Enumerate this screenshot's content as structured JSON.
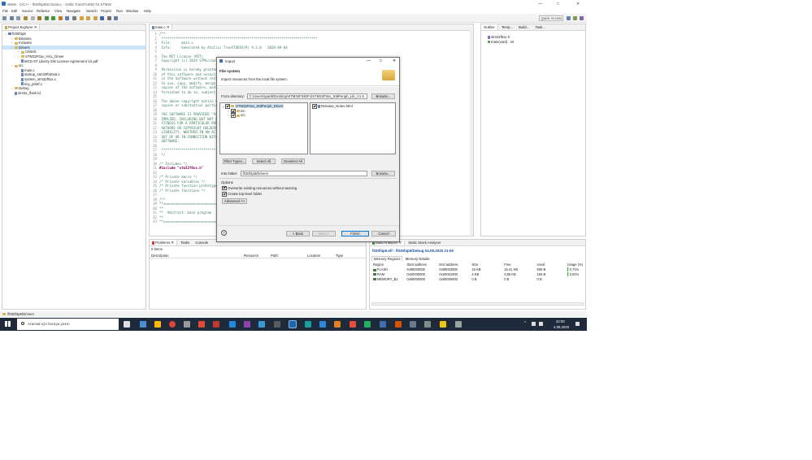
{
  "window": {
    "title": "stsMn - C/C++ - f030f4p6/src/main.c - Atollic TrueSTUDIO for STM32",
    "controls": [
      "—",
      "□",
      "✕"
    ]
  },
  "menu": [
    "File",
    "Edit",
    "Source",
    "Refactor",
    "View",
    "Navigate",
    "Search",
    "Project",
    "Run",
    "Window",
    "Help"
  ],
  "toolbar": {
    "quick_access": "Quick Access"
  },
  "project_explorer": {
    "tab": "Project Explorer",
    "tree": [
      {
        "label": "f030f4p6",
        "depth": 0,
        "kind": "project"
      },
      {
        "label": "Binaries",
        "depth": 1,
        "kind": "folder"
      },
      {
        "label": "Includes",
        "depth": 1,
        "kind": "folder"
      },
      {
        "label": "Drivers",
        "depth": 1,
        "kind": "folder",
        "selected": true
      },
      {
        "label": "CMSIS",
        "depth": 2,
        "kind": "folder"
      },
      {
        "label": "STM32F0xx_HAL_Driver",
        "depth": 2,
        "kind": "folder"
      },
      {
        "label": "MCD-ST Liberty SW License Agreement V2.pdf",
        "depth": 2,
        "kind": "file"
      },
      {
        "label": "src",
        "depth": 1,
        "kind": "folder"
      },
      {
        "label": "main.c",
        "depth": 2,
        "kind": "file"
      },
      {
        "label": "startup_stm32f030x6.s",
        "depth": 2,
        "kind": "file"
      },
      {
        "label": "system_stm32f0xx.c",
        "depth": 2,
        "kind": "file"
      },
      {
        "label": "tiny_printf.c",
        "depth": 2,
        "kind": "file"
      },
      {
        "label": "Debug",
        "depth": 1,
        "kind": "folder"
      },
      {
        "label": "stm32_flash.ld",
        "depth": 1,
        "kind": "file"
      }
    ]
  },
  "editor": {
    "tab": "main.c",
    "lines": [
      {
        "n": "1",
        "text": "/**",
        "cls": "cmt"
      },
      {
        "n": "2",
        "text": " ******************************************************************************",
        "cls": "cmt"
      },
      {
        "n": "3",
        "text": " File:     main.c",
        "cls": "cmt"
      },
      {
        "n": "4",
        "text": " Info:     Generated by Atollic TrueSTUDIO(R) 9.3.0   2020-09-04",
        "cls": "cmt"
      },
      {
        "n": "5",
        "text": "",
        "cls": "cmt"
      },
      {
        "n": "6",
        "text": " The MIT License (MIT)",
        "cls": "cmt"
      },
      {
        "n": "7",
        "text": " Copyright (c) 2019 STMicroelectronics",
        "cls": "cmt"
      },
      {
        "n": "8",
        "text": "",
        "cls": "cmt"
      },
      {
        "n": "9",
        "text": " Permission is hereby granted, free of charge, to any person obtaining a copy",
        "cls": "cmt"
      },
      {
        "n": "10",
        "text": " of this software and associated documentation files (the \"Software\"), to deal",
        "cls": "cmt"
      },
      {
        "n": "11",
        "text": " in the Software without restriction, including without limitation the rights",
        "cls": "cmt"
      },
      {
        "n": "12",
        "text": " to use, copy, modify, merge, publish, distribute, sublicense, and/or sell",
        "cls": "cmt"
      },
      {
        "n": "13",
        "text": " copies of the Software, and to permit persons to whom the Software is",
        "cls": "cmt"
      },
      {
        "n": "14",
        "text": " furnished to do so, subject to the following conditions:",
        "cls": "cmt"
      },
      {
        "n": "15",
        "text": "",
        "cls": "cmt"
      },
      {
        "n": "16",
        "text": " The above copyright notice and this permission notice shall be included in all",
        "cls": "cmt"
      },
      {
        "n": "17",
        "text": " copies or substantial portions of the Software.",
        "cls": "cmt"
      },
      {
        "n": "18",
        "text": "",
        "cls": "cmt"
      },
      {
        "n": "19",
        "text": " THE SOFTWARE IS PROVIDED \"AS IS\", WITHOUT WARRANTY OF ANY KIND, EXPRESS OR",
        "cls": "cmt"
      },
      {
        "n": "20",
        "text": " IMPLIED, INCLUDING BUT NOT LIMITED TO THE WARRANTIES OF MERCHANTABILITY,",
        "cls": "cmt"
      },
      {
        "n": "21",
        "text": " FITNESS FOR A PARTICULAR PURPOSE AND NONINFRINGEMENT. IN NO EVENT SHALL THE",
        "cls": "cmt"
      },
      {
        "n": "22",
        "text": " AUTHORS OR COPYRIGHT HOLDERS BE LIABLE FOR ANY CLAIM, DAMAGES OR OTHER",
        "cls": "cmt"
      },
      {
        "n": "23",
        "text": " LIABILITY, WHETHER IN AN ACTION OF CONTRACT, TORT OR OTHERWISE, ARISING FROM,",
        "cls": "cmt"
      },
      {
        "n": "24",
        "text": " OUT OF OR IN CONNECTION WITH THE SOFTWARE OR THE USE OR OTHER DEALINGS IN THE",
        "cls": "cmt"
      },
      {
        "n": "25",
        "text": " SOFTWARE.",
        "cls": "cmt"
      },
      {
        "n": "26",
        "text": "",
        "cls": "cmt"
      },
      {
        "n": "27",
        "text": " ******************************************************************************",
        "cls": "cmt"
      },
      {
        "n": "28",
        "text": " */",
        "cls": "cmt"
      },
      {
        "n": "29",
        "text": "",
        "cls": ""
      },
      {
        "n": "30",
        "text": "/* Includes */",
        "cls": "cmt"
      },
      {
        "n": "31",
        "text": "#include \"stm32f0xx.h\"",
        "cls": "kw"
      },
      {
        "n": "32",
        "text": "",
        "cls": ""
      },
      {
        "n": "33",
        "text": "/* Private macro */",
        "cls": "cmt"
      },
      {
        "n": "34",
        "text": "/* Private variables */",
        "cls": "cmt"
      },
      {
        "n": "35",
        "text": "/* Private function prototypes */",
        "cls": "cmt"
      },
      {
        "n": "36",
        "text": "/* Private functions */",
        "cls": "cmt"
      },
      {
        "n": "37",
        "text": "",
        "cls": ""
      },
      {
        "n": "38",
        "text": "/**",
        "cls": "cmt"
      },
      {
        "n": "39",
        "text": "**===========================================================================",
        "cls": "cmt"
      },
      {
        "n": "40",
        "text": "**",
        "cls": "cmt"
      },
      {
        "n": "41",
        "text": "**  Abstract: main program",
        "cls": "cmt"
      },
      {
        "n": "42",
        "text": "**",
        "cls": "cmt"
      },
      {
        "n": "43",
        "text": "**===========================================================================",
        "cls": "cmt"
      }
    ]
  },
  "outline": {
    "tabs": [
      "Outline",
      "Temp...",
      "Build...",
      "Task..."
    ],
    "items": [
      "stm32f0xx.h",
      "main(void) : int"
    ]
  },
  "problems": {
    "tabs": [
      "Problems",
      "Tasks",
      "Console"
    ],
    "count": "0 items",
    "columns": [
      "Description",
      "Resource",
      "Path",
      "Location",
      "Type"
    ]
  },
  "build_analyzer": {
    "tabs": [
      "Build Analyzer",
      "Static Stack Analyzer"
    ],
    "header": "f030f4p6.elf - /f030f4p6/Debug   04.09.2020 21:50",
    "subtabs": [
      "Memory Regions",
      "Memory Details"
    ],
    "columns": [
      "Region",
      "Start address",
      "End address",
      "Size",
      "Free",
      "Used",
      "Usage (%)"
    ],
    "rows": [
      {
        "region": "FLASH",
        "start": "0x08000000",
        "end": "0x08004000",
        "size": "16 KB",
        "free": "15,41 KB",
        "used": "608 B",
        "usage": "3,71%",
        "pct": 3.71
      },
      {
        "region": "RAM",
        "start": "0x20000000",
        "end": "0x20001000",
        "size": "4 KB",
        "free": "3,85 KB",
        "used": "156 B",
        "usage": "3,81%",
        "pct": 3.81
      },
      {
        "region": "MEMORY_B1",
        "start": "0x60000000",
        "end": "0x60000000",
        "size": "0 B",
        "free": "0 B",
        "used": "0 B",
        "usage": "",
        "pct": 0
      }
    ]
  },
  "status_bar": {
    "path": "/f030f4p6/Drivers"
  },
  "dialog": {
    "title": "Import",
    "heading": "File system",
    "description": "Import resources from the local file system.",
    "from_dir_label": "From directory:",
    "from_dir_value": "C:\\Users\\sparkt\\Desktop\\STM32F030F4\\STM32F0xx_StdPeriph_Lib_V1.5",
    "browse": "Browse...",
    "tree": [
      {
        "label": "STM32F0xx_StdPeriph_Driver",
        "depth": 0,
        "checked": true,
        "selected": true
      },
      {
        "label": "inc",
        "depth": 1,
        "checked": true
      },
      {
        "label": "src",
        "depth": 1,
        "checked": true
      }
    ],
    "files": [
      {
        "label": "Release_Notes.html",
        "checked": true
      }
    ],
    "filter_types": "Filter Types...",
    "select_all": "Select All",
    "deselect_all": "Deselect All",
    "into_label": "Into folder:",
    "into_value": "f030f4p6/Drivers",
    "options_label": "Options",
    "overwrite": "Overwrite existing resources without warning",
    "create_top": "Create top-level folder",
    "advanced": "Advanced >>",
    "help": "?",
    "back": "< Back",
    "next": "Next >",
    "finish": "Finish",
    "cancel": "Cancel"
  },
  "taskbar": {
    "search": "Aramak için buraya yazın",
    "time": "22:00",
    "date": "4.09.2020"
  }
}
